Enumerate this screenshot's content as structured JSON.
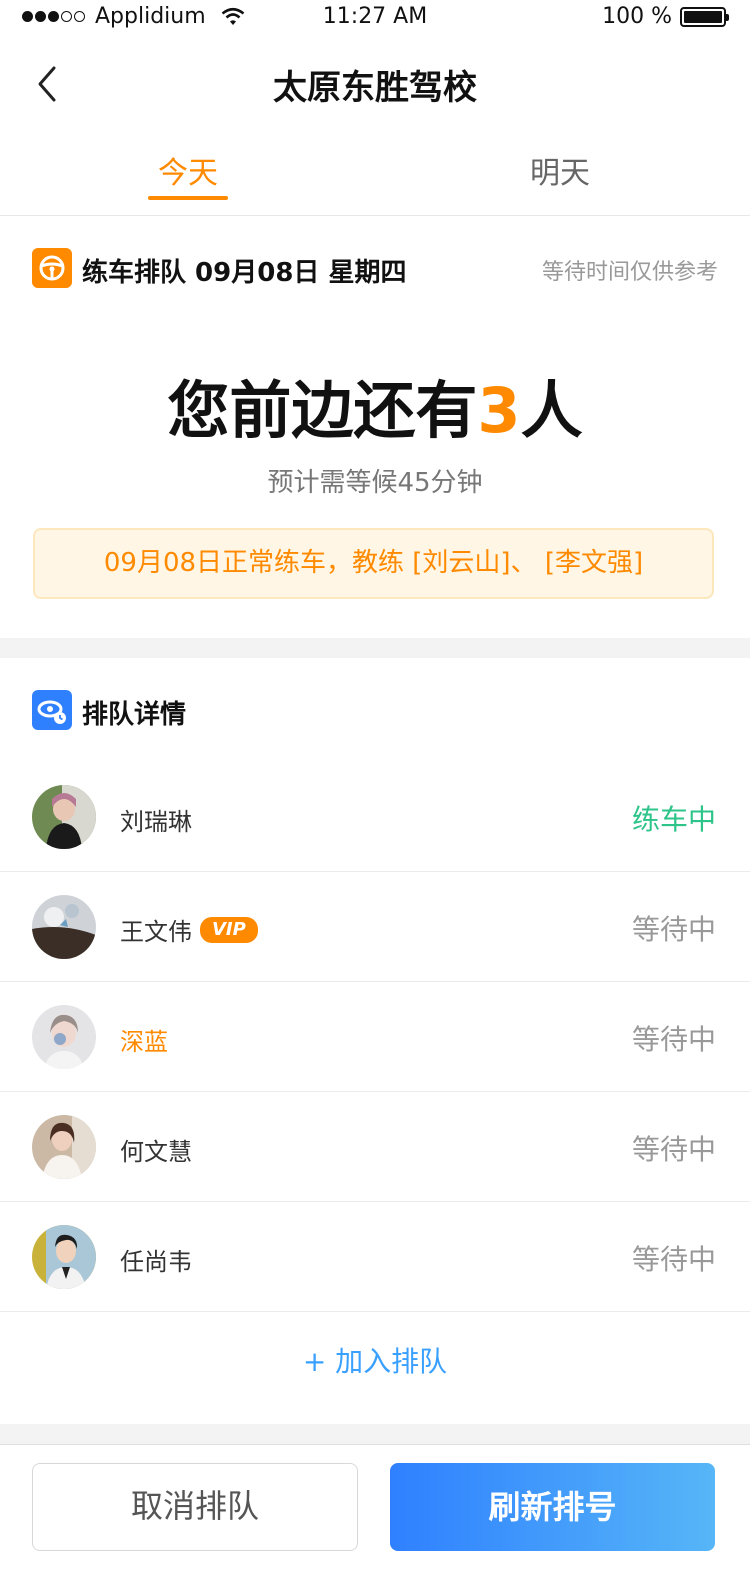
{
  "status_bar": {
    "carrier": "Applidium",
    "time": "11:27 AM",
    "battery": "100 %"
  },
  "nav": {
    "title": "太原东胜驾校"
  },
  "tabs": [
    {
      "label": "今天",
      "active": true
    },
    {
      "label": "明天",
      "active": false
    }
  ],
  "queue": {
    "title": "练车排队 09月08日 星期四",
    "note": "等待时间仅供参考",
    "ahead_prefix": "您前边还有",
    "ahead_count": "3",
    "ahead_suffix": "人",
    "wait_text": "预计需等候45分钟",
    "notice": "09月08日正常练车，教练 [刘云山]、 [李文强]"
  },
  "details": {
    "title": "排队详情",
    "rows": [
      {
        "name": "刘瑞琳",
        "status": "练车中",
        "vip": false,
        "highlight": false,
        "active": true
      },
      {
        "name": "王文伟",
        "status": "等待中",
        "vip": true,
        "vip_label": "VIP",
        "highlight": false,
        "active": false
      },
      {
        "name": "深蓝",
        "status": "等待中",
        "vip": false,
        "highlight": true,
        "active": false
      },
      {
        "name": "何文慧",
        "status": "等待中",
        "vip": false,
        "highlight": false,
        "active": false
      },
      {
        "name": "任尚韦",
        "status": "等待中",
        "vip": false,
        "highlight": false,
        "active": false
      }
    ],
    "join_label": "+ 加入排队"
  },
  "buttons": {
    "cancel": "取消排队",
    "refresh": "刷新排号"
  },
  "colors": {
    "accent": "#ff8a00",
    "practice": "#2dc48a",
    "primary": "#2f80ff",
    "link": "#3aa0ff"
  }
}
